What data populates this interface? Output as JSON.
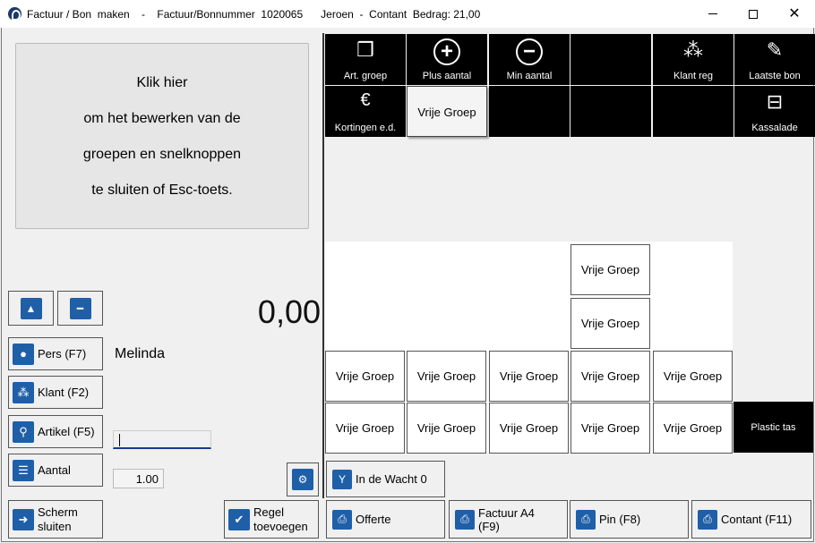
{
  "window": {
    "title": "Factuur / Bon  maken    -    Factuur/Bonnummer  1020065      Jeroen  -  Contant  Bedrag: 21,00",
    "controls": [
      "minimize-icon",
      "maximize-icon",
      "close-icon"
    ]
  },
  "info_panel": {
    "lines": [
      "Klik hier",
      "om het bewerken van de",
      "groepen en snelknoppen",
      "te sluiten of Esc-toets."
    ]
  },
  "amount": "0,00",
  "left_buttons": {
    "pers": "Pers (F7)",
    "klant": "Klant (F2)",
    "artikel": "Artikel (F5)",
    "aantal": "Aantal",
    "scherm_sluiten": "Scherm\nsluiten",
    "regel_toevoegen": "Regel\ntoevoegen"
  },
  "pers_value": "Melinda",
  "artikel_input_value": "",
  "aantal_value": "1.00",
  "quick_tiles": {
    "art_groep": "Art. groep",
    "plus_aantal": "Plus aantal",
    "min_aantal": "Min aantal",
    "klant_reg": "Klant reg",
    "laatste_bon": "Laatste bon",
    "kortingen": "Kortingen e.d.",
    "vrije_groep": "Vrije Groep",
    "kassalade": "Kassalade"
  },
  "group_label": "Vrije Groep",
  "plastic_tas": "Plastic tas",
  "bottom_buttons": {
    "in_de_wacht": "In de Wacht 0",
    "offerte": "Offerte",
    "factuur_a4": "Factuur A4\n(F9)",
    "pin": "Pin (F8)",
    "contant": "Contant (F11)"
  },
  "colors": {
    "accent": "#1f5fa8",
    "tile": "#000000",
    "background": "#f0f0f0"
  }
}
